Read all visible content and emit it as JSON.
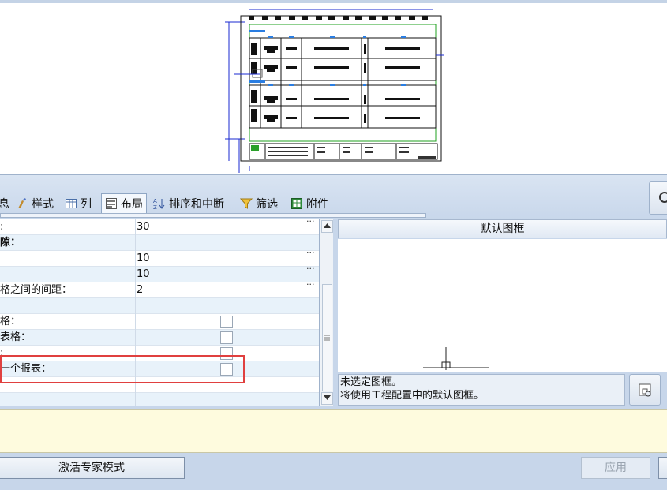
{
  "tabs": [
    {
      "label": "息",
      "icon": "info-icon"
    },
    {
      "label": "样式",
      "icon": "style-brush-icon"
    },
    {
      "label": "列",
      "icon": "columns-icon"
    },
    {
      "label": "布局",
      "icon": "layout-icon"
    },
    {
      "label": "排序和中断",
      "icon": "sort-az-icon"
    },
    {
      "label": "筛选",
      "icon": "filter-funnel-icon"
    },
    {
      "label": "附件",
      "icon": "attachment-sheet-icon"
    }
  ],
  "active_tab": "布局",
  "grid": {
    "rows": [
      {
        "label": ":",
        "value": "30",
        "ellipsis": "···"
      },
      {
        "label": "隙：",
        "value": "",
        "ellipsis": ""
      },
      {
        "label": "",
        "value": "10",
        "ellipsis": "···"
      },
      {
        "label": "",
        "value": "10",
        "ellipsis": "···"
      },
      {
        "label": "格之间的间距：",
        "value": "2",
        "ellipsis": "···"
      },
      {
        "label": "",
        "value": "",
        "ellipsis": ""
      },
      {
        "label": "格：",
        "value": "",
        "ellipsis": ""
      },
      {
        "label": "表格：",
        "value": "",
        "ellipsis": ""
      },
      {
        "label": ":",
        "value": "",
        "ellipsis": ""
      },
      {
        "label": "一个报表：",
        "value": "",
        "ellipsis": ""
      },
      {
        "label": "",
        "value": "",
        "ellipsis": ""
      },
      {
        "label": "",
        "value": "",
        "ellipsis": ""
      }
    ]
  },
  "frame_panel": {
    "title": "默认图框",
    "message_line1": "未选定图框。",
    "message_line2": "将使用工程配置中的默认图框。"
  },
  "buttons": {
    "expert_mode": "激活专家模式",
    "apply": "应用"
  },
  "colors": {
    "highlight_box": "#e0403f",
    "notes_bg": "#fefbde",
    "window_bg": "#c7d6ea"
  }
}
